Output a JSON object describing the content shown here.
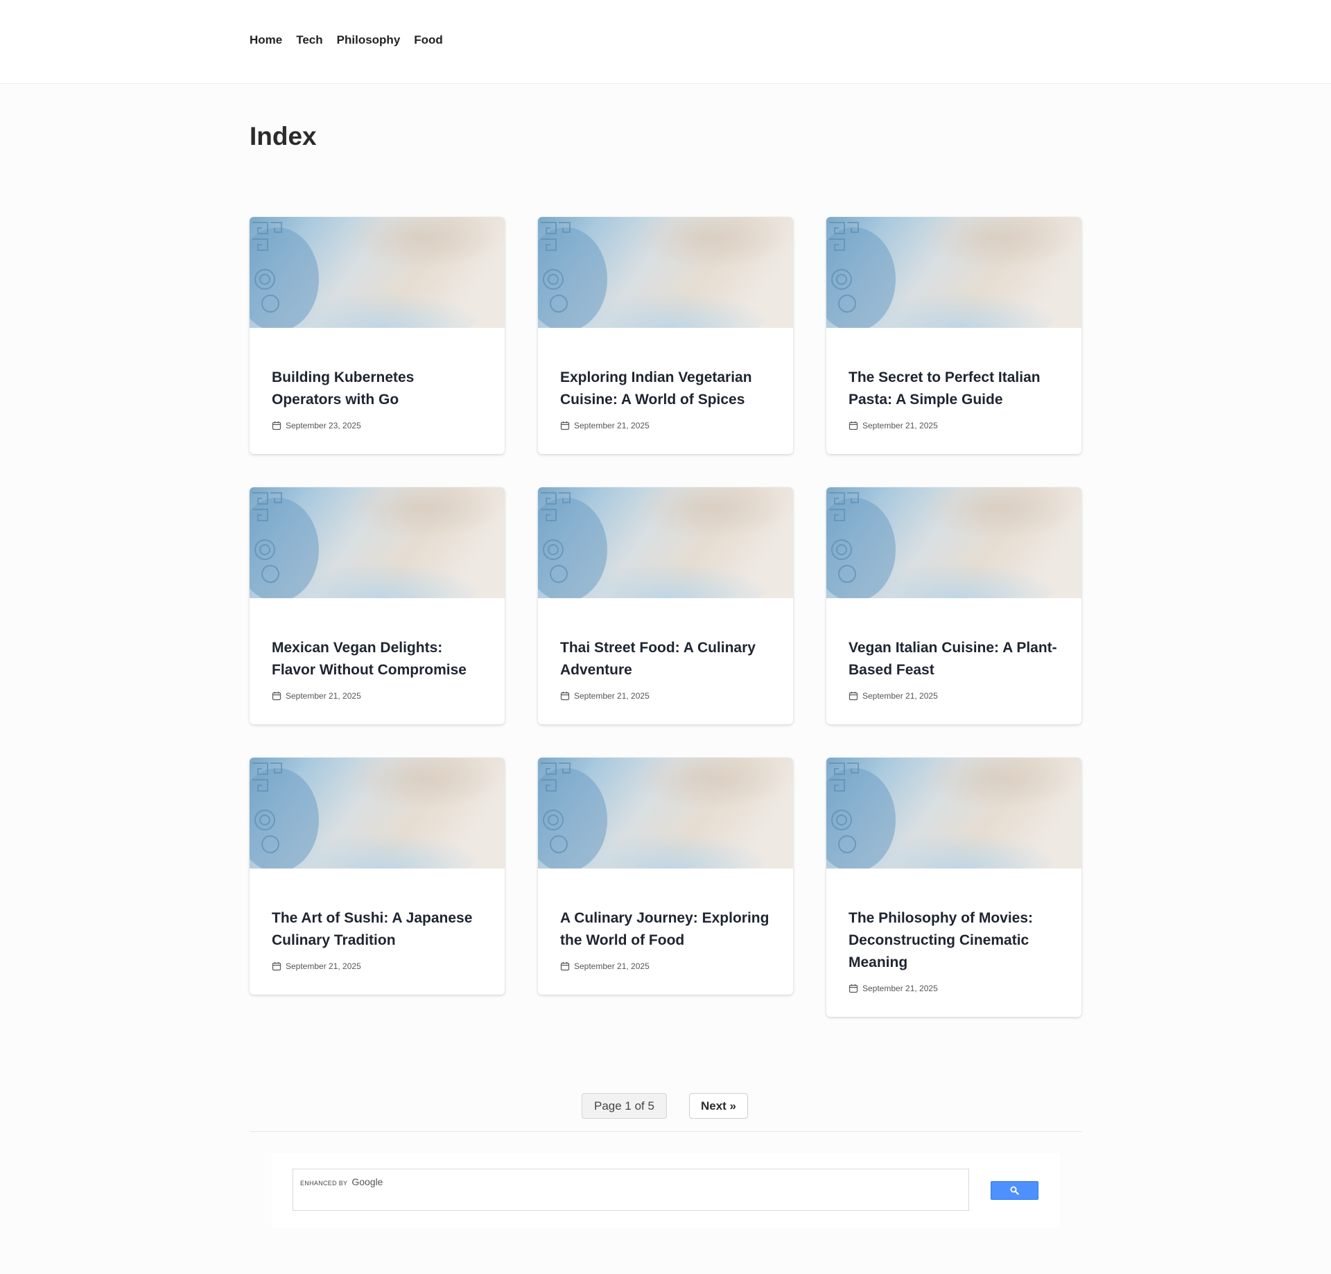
{
  "nav": {
    "items": [
      {
        "label": "Home"
      },
      {
        "label": "Tech"
      },
      {
        "label": "Philosophy"
      },
      {
        "label": "Food"
      }
    ]
  },
  "page": {
    "title": "Index"
  },
  "posts": [
    {
      "title": "Building Kubernetes Operators with Go",
      "date": "September 23, 2025"
    },
    {
      "title": "Exploring Indian Vegetarian Cuisine: A World of Spices",
      "date": "September 21, 2025"
    },
    {
      "title": "The Secret to Perfect Italian Pasta: A Simple Guide",
      "date": "September 21, 2025"
    },
    {
      "title": "Mexican Vegan Delights: Flavor Without Compromise",
      "date": "September 21, 2025"
    },
    {
      "title": "Thai Street Food: A Culinary Adventure",
      "date": "September 21, 2025"
    },
    {
      "title": "Vegan Italian Cuisine: A Plant-Based Feast",
      "date": "September 21, 2025"
    },
    {
      "title": "The Art of Sushi: A Japanese Culinary Tradition",
      "date": "September 21, 2025"
    },
    {
      "title": "A Culinary Journey: Exploring the World of Food",
      "date": "September 21, 2025"
    },
    {
      "title": "The Philosophy of Movies: Deconstructing Cinematic Meaning",
      "date": "September 21, 2025"
    }
  ],
  "pagination": {
    "indicator": "Page 1 of 5",
    "next_label": "Next »"
  },
  "search": {
    "enhanced_by": "ENHANCED BY",
    "brand": "Google",
    "button_icon": "search-icon"
  },
  "colors": {
    "search_button": "#4d90fe",
    "thumb_blue": "#8fb8d6",
    "thumb_beige": "#e8e0d4"
  }
}
